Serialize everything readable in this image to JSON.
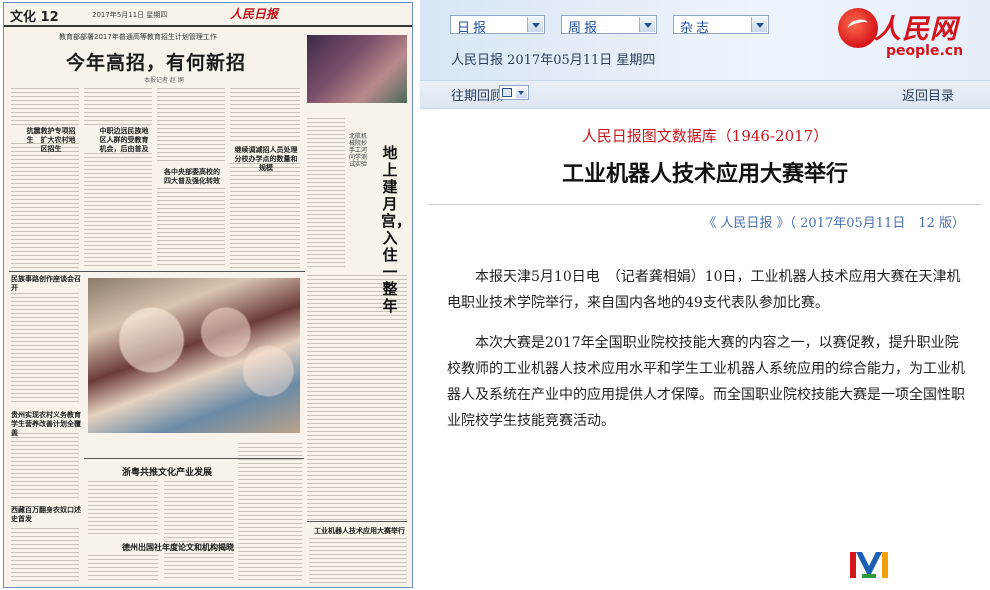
{
  "newspaper": {
    "section": "文化 12",
    "date": "2017年5月11日 星期四",
    "logo": "人民日报",
    "kicker": "教育部部署2017年普通高等教育招生计划管理工作",
    "headline": "今年高招，有何新招",
    "byline": "本报记者 赵 婀",
    "subheads": [
      "抗震救护专项招生　扩大农村地区招生",
      "中职边远民族地区人群的受教育机会，后由普及",
      "继续调减招人员处理分校办学点的数量和规模",
      "各中央部委高校的四大普及强化转效",
      "继续调减招人员处理分校办学点的数量和规模"
    ],
    "vertical_title": "地上建月宫，入住一整年",
    "vertical_small": "北航机械院抄手工河问学测试实验",
    "left_heads": [
      "民族事路创作座谈会召开",
      "贵州实现农村义务教育学生营养改善计划全覆盖",
      "西藏百万翻身农奴口述史首发"
    ],
    "bottom_heads": [
      "浙粤共推文化产业发展",
      "德州出国社年度论文和机构揭晓",
      "工业机器人技术应用大赛举行"
    ]
  },
  "topbar": {
    "selects": [
      "日报",
      "周报",
      "杂志"
    ],
    "date_line": "人民日报 2017年05月11日 星期四",
    "logo_cn": "人民网",
    "logo_en": "people.cn"
  },
  "nav": {
    "back_issue": "往期回顾",
    "return_link": "返回目录"
  },
  "article": {
    "db_title": "人民日报图文数据库（1946-2017）",
    "title": "工业机器人技术应用大赛举行",
    "source": "《 人民日报 》（ 2017年05月11日　12 版）",
    "paragraphs": [
      "本报天津5月10日电　（记者龚相娟）10日，工业机器人技术应用大赛在天津机电职业技术学院举行，来自国内各地的49支代表队参加比赛。",
      "本次大赛是2017年全国职业院校技能大赛的内容之一，以赛促教，提升职业院校教师的工业机器人技术应用水平和学生工业机器人系统应用的综合能力，为工业机器人及系统在产业中的应用提供人才保障。而全国职业院校技能大赛是一项全国性职业院校学生技能竞赛活动。"
    ]
  },
  "colors": {
    "accent_red": "#c8161d",
    "link_blue": "#4a6fae",
    "select_text": "#1e4fa0"
  }
}
